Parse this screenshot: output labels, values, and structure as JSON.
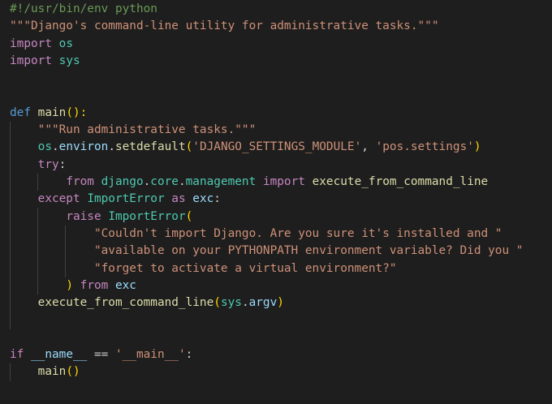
{
  "editor": {
    "language": "python",
    "lines": [
      [
        {
          "t": "#!/usr/bin/env python",
          "c": "comment"
        }
      ],
      [
        {
          "t": "\"\"\"Django's command-line utility for administrative tasks.\"\"\"",
          "c": "string"
        }
      ],
      [
        {
          "t": "import",
          "c": "keyword"
        },
        {
          "t": " ",
          "c": "plain"
        },
        {
          "t": "os",
          "c": "module"
        }
      ],
      [
        {
          "t": "import",
          "c": "keyword"
        },
        {
          "t": " ",
          "c": "plain"
        },
        {
          "t": "sys",
          "c": "module"
        }
      ],
      [],
      [],
      [
        {
          "t": "def",
          "c": "def"
        },
        {
          "t": " ",
          "c": "plain"
        },
        {
          "t": "main",
          "c": "func"
        },
        {
          "t": "():",
          "c": "bracket1"
        }
      ],
      [
        {
          "t": "    ",
          "c": "plain"
        },
        {
          "t": "\"\"\"Run administrative tasks.\"\"\"",
          "c": "string"
        }
      ],
      [
        {
          "t": "    ",
          "c": "plain"
        },
        {
          "t": "os",
          "c": "module"
        },
        {
          "t": ".",
          "c": "punct"
        },
        {
          "t": "environ",
          "c": "var"
        },
        {
          "t": ".",
          "c": "punct"
        },
        {
          "t": "setdefault",
          "c": "func"
        },
        {
          "t": "(",
          "c": "bracket1"
        },
        {
          "t": "'DJANGO_SETTINGS_MODULE'",
          "c": "string"
        },
        {
          "t": ", ",
          "c": "punct"
        },
        {
          "t": "'pos.settings'",
          "c": "string"
        },
        {
          "t": ")",
          "c": "bracket1"
        }
      ],
      [
        {
          "t": "    ",
          "c": "plain"
        },
        {
          "t": "try",
          "c": "keyword"
        },
        {
          "t": ":",
          "c": "punct"
        }
      ],
      [
        {
          "t": "        ",
          "c": "plain"
        },
        {
          "t": "from",
          "c": "keyword"
        },
        {
          "t": " ",
          "c": "plain"
        },
        {
          "t": "django",
          "c": "module"
        },
        {
          "t": ".",
          "c": "punct"
        },
        {
          "t": "core",
          "c": "module"
        },
        {
          "t": ".",
          "c": "punct"
        },
        {
          "t": "management",
          "c": "module"
        },
        {
          "t": " ",
          "c": "plain"
        },
        {
          "t": "import",
          "c": "keyword"
        },
        {
          "t": " ",
          "c": "plain"
        },
        {
          "t": "execute_from_command_line",
          "c": "func"
        }
      ],
      [
        {
          "t": "    ",
          "c": "plain"
        },
        {
          "t": "except",
          "c": "keyword"
        },
        {
          "t": " ",
          "c": "plain"
        },
        {
          "t": "ImportError",
          "c": "class"
        },
        {
          "t": " ",
          "c": "plain"
        },
        {
          "t": "as",
          "c": "keyword"
        },
        {
          "t": " ",
          "c": "plain"
        },
        {
          "t": "exc",
          "c": "var"
        },
        {
          "t": ":",
          "c": "punct"
        }
      ],
      [
        {
          "t": "        ",
          "c": "plain"
        },
        {
          "t": "raise",
          "c": "keyword"
        },
        {
          "t": " ",
          "c": "plain"
        },
        {
          "t": "ImportError",
          "c": "class"
        },
        {
          "t": "(",
          "c": "bracket1"
        }
      ],
      [
        {
          "t": "            ",
          "c": "plain"
        },
        {
          "t": "\"Couldn't import Django. Are you sure it's installed and \"",
          "c": "string"
        }
      ],
      [
        {
          "t": "            ",
          "c": "plain"
        },
        {
          "t": "\"available on your PYTHONPATH environment variable? Did you \"",
          "c": "string"
        }
      ],
      [
        {
          "t": "            ",
          "c": "plain"
        },
        {
          "t": "\"forget to activate a virtual environment?\"",
          "c": "string"
        }
      ],
      [
        {
          "t": "        ",
          "c": "plain"
        },
        {
          "t": ")",
          "c": "bracket1"
        },
        {
          "t": " ",
          "c": "plain"
        },
        {
          "t": "from",
          "c": "keyword"
        },
        {
          "t": " ",
          "c": "plain"
        },
        {
          "t": "exc",
          "c": "var"
        }
      ],
      [
        {
          "t": "    ",
          "c": "plain"
        },
        {
          "t": "execute_from_command_line",
          "c": "func"
        },
        {
          "t": "(",
          "c": "bracket1"
        },
        {
          "t": "sys",
          "c": "module"
        },
        {
          "t": ".",
          "c": "punct"
        },
        {
          "t": "argv",
          "c": "var"
        },
        {
          "t": ")",
          "c": "bracket1"
        }
      ],
      [],
      [],
      [
        {
          "t": "if",
          "c": "keyword"
        },
        {
          "t": " ",
          "c": "plain"
        },
        {
          "t": "__name__",
          "c": "var"
        },
        {
          "t": " == ",
          "c": "punct"
        },
        {
          "t": "'__main__'",
          "c": "string"
        },
        {
          "t": ":",
          "c": "punct"
        }
      ],
      [
        {
          "t": "    ",
          "c": "plain"
        },
        {
          "t": "main",
          "c": "func"
        },
        {
          "t": "()",
          "c": "bracket1"
        }
      ]
    ]
  }
}
